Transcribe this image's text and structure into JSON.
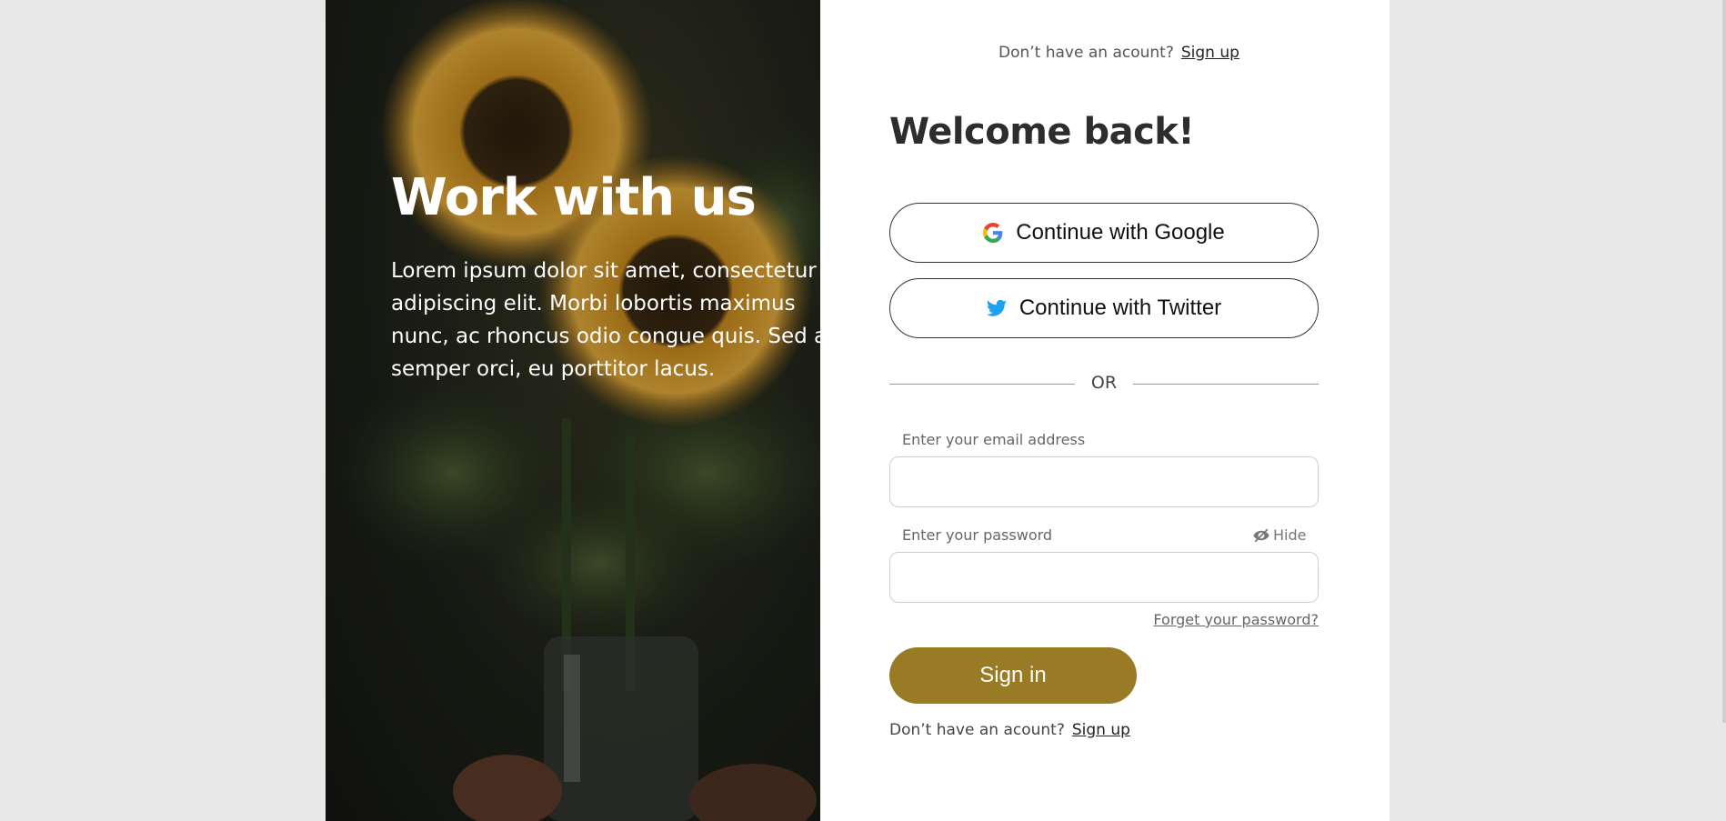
{
  "hero": {
    "title": "Work with us",
    "text": "Lorem ipsum dolor sit amet, consectetur adipiscing elit. Morbi lobortis maximus nunc, ac rhoncus odio congue quis. Sed ac semper orci, eu porttitor lacus."
  },
  "top_signup": {
    "prompt": "Don’t have an acount?",
    "link": "Sign up"
  },
  "login": {
    "welcome": "Welcome back!",
    "google_label": "Continue with Google",
    "twitter_label": "Continue with Twitter",
    "or_text": "OR",
    "email_label": "Enter your email address",
    "email_value": "",
    "password_label": "Enter your password",
    "password_value": "",
    "hide_label": "Hide",
    "forgot_label": "Forget your password?",
    "signin_label": "Sign in"
  },
  "bottom_signup": {
    "prompt": "Don’t have an acount?",
    "link": "Sign up"
  },
  "colors": {
    "accent": "#997a25",
    "twitter": "#1da1f2",
    "background": "#e8e8e8"
  }
}
